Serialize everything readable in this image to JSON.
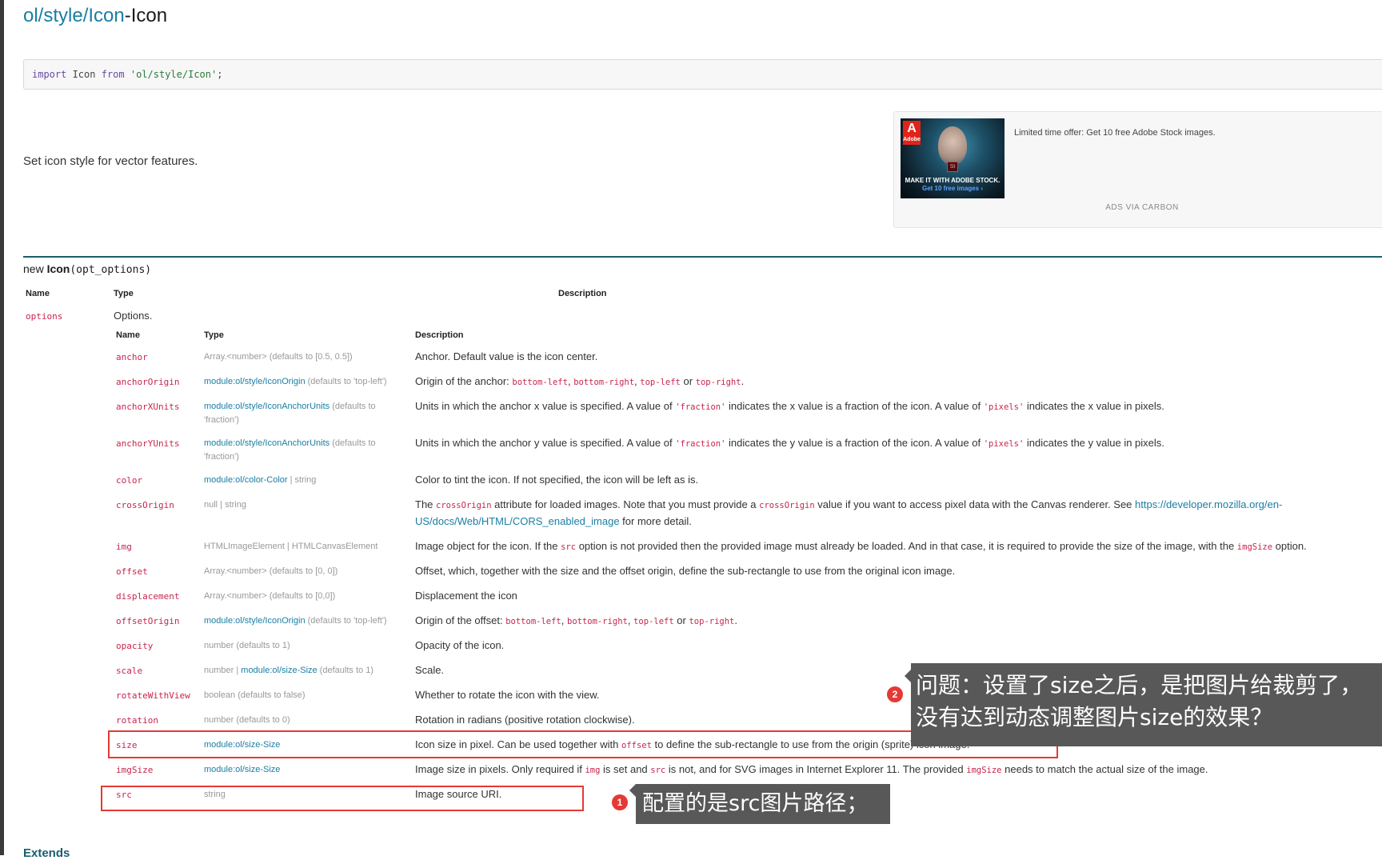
{
  "page": {
    "title_path": "ol/style/Icon",
    "title_suffix": "-Icon",
    "import_kw1": "import",
    "import_name": " Icon ",
    "import_kw2": "from",
    "import_str": " 'ol/style/Icon'",
    "import_end": ";",
    "summary": "Set icon style for vector features."
  },
  "ad": {
    "logo_text": "Adobe",
    "st_text": "St",
    "image_headline": "MAKE IT WITH ADOBE STOCK.",
    "image_cta": "Get 10 free images ›",
    "text": "Limited time offer: Get 10 free Adobe Stock images.",
    "via": "ADS VIA CARBON"
  },
  "constructor": {
    "prefix": "new ",
    "name": "Icon",
    "args": "(opt_options)"
  },
  "outer_headers": {
    "name": "Name",
    "type": "Type",
    "description": "Description"
  },
  "outer_row": {
    "name": "options",
    "type": "Options."
  },
  "inner_headers": {
    "name": "Name",
    "type": "Type",
    "description": "Description"
  },
  "options": [
    {
      "name": "anchor",
      "type_link": "",
      "type_text": "Array.<number> (defaults to [0.5, 0.5])",
      "type_text2": "",
      "desc": [
        {
          "t": "Anchor. Default value is the icon center."
        }
      ]
    },
    {
      "name": "anchorOrigin",
      "type_link": "module:ol/style/IconOrigin",
      "type_text": " (defaults to 'top-left')",
      "type_text2": "",
      "desc": [
        {
          "t": "Origin of the anchor: "
        },
        {
          "c": "bottom-left"
        },
        {
          "t": ", "
        },
        {
          "c": "bottom-right"
        },
        {
          "t": ", "
        },
        {
          "c": "top-left"
        },
        {
          "t": " or "
        },
        {
          "c": "top-right"
        },
        {
          "t": "."
        }
      ]
    },
    {
      "name": "anchorXUnits",
      "type_link": "module:ol/style/IconAnchorUnits",
      "type_text": " (defaults to 'fraction')",
      "type_text2": "",
      "desc": [
        {
          "t": "Units in which the anchor x value is specified. A value of "
        },
        {
          "c": "'fraction'"
        },
        {
          "t": " indicates the x value is a fraction of the icon. A value of "
        },
        {
          "c": "'pixels'"
        },
        {
          "t": " indicates the x value in pixels."
        }
      ]
    },
    {
      "name": "anchorYUnits",
      "type_link": "module:ol/style/IconAnchorUnits",
      "type_text": " (defaults to 'fraction')",
      "type_text2": "",
      "desc": [
        {
          "t": "Units in which the anchor y value is specified. A value of "
        },
        {
          "c": "'fraction'"
        },
        {
          "t": " indicates the y value is a fraction of the icon. A value of "
        },
        {
          "c": "'pixels'"
        },
        {
          "t": " indicates the y value in pixels."
        }
      ]
    },
    {
      "name": "color",
      "type_link": "module:ol/color-Color",
      "type_text": " | string",
      "type_text2": "",
      "desc": [
        {
          "t": "Color to tint the icon. If not specified, the icon will be left as is."
        }
      ]
    },
    {
      "name": "crossOrigin",
      "type_link": "",
      "type_text": "null | string",
      "type_text2": "",
      "desc": [
        {
          "t": "The "
        },
        {
          "c": "crossOrigin"
        },
        {
          "t": " attribute for loaded images. Note that you must provide a "
        },
        {
          "c": "crossOrigin"
        },
        {
          "t": " value if you want to access pixel data with the Canvas renderer. See "
        },
        {
          "u": "https://developer.mozilla.org/en-US/docs/Web/HTML/CORS_enabled_image"
        },
        {
          "t": " for more detail."
        }
      ]
    },
    {
      "name": "img",
      "type_link": "",
      "type_text": "HTMLImageElement | HTMLCanvasElement",
      "type_text2": "",
      "desc": [
        {
          "t": "Image object for the icon. If the "
        },
        {
          "c": "src"
        },
        {
          "t": " option is not provided then the provided image must already be loaded. And in that case, it is required to provide the size of the image, with the "
        },
        {
          "c": "imgSize"
        },
        {
          "t": " option."
        }
      ]
    },
    {
      "name": "offset",
      "type_link": "",
      "type_text": "Array.<number> (defaults to [0, 0])",
      "type_text2": "",
      "desc": [
        {
          "t": "Offset, which, together with the size and the offset origin, define the sub-rectangle to use from the original icon image."
        }
      ]
    },
    {
      "name": "displacement",
      "type_link": "",
      "type_text": "Array.<number> (defaults to [0,0])",
      "type_text2": "",
      "desc": [
        {
          "t": "Displacement the icon"
        }
      ]
    },
    {
      "name": "offsetOrigin",
      "type_link": "module:ol/style/IconOrigin",
      "type_text": " (defaults to 'top-left')",
      "type_text2": "",
      "desc": [
        {
          "t": "Origin of the offset: "
        },
        {
          "c": "bottom-left"
        },
        {
          "t": ", "
        },
        {
          "c": "bottom-right"
        },
        {
          "t": ", "
        },
        {
          "c": "top-left"
        },
        {
          "t": " or "
        },
        {
          "c": "top-right"
        },
        {
          "t": "."
        }
      ]
    },
    {
      "name": "opacity",
      "type_link": "",
      "type_text": "number (defaults to 1)",
      "type_text2": "",
      "desc": [
        {
          "t": "Opacity of the icon."
        }
      ]
    },
    {
      "name": "scale",
      "type_link": "module:ol/size-Size",
      "type_pre": "number | ",
      "type_text": " (defaults to 1)",
      "type_text2": "",
      "desc": [
        {
          "t": "Scale."
        }
      ]
    },
    {
      "name": "rotateWithView",
      "type_link": "",
      "type_text": "boolean (defaults to false)",
      "type_text2": "",
      "desc": [
        {
          "t": "Whether to rotate the icon with the view."
        }
      ]
    },
    {
      "name": "rotation",
      "type_link": "",
      "type_text": "number (defaults to 0)",
      "type_text2": "",
      "desc": [
        {
          "t": "Rotation in radians (positive rotation clockwise)."
        }
      ]
    },
    {
      "name": "size",
      "type_link": "module:ol/size-Size",
      "type_text": "",
      "type_text2": "",
      "desc": [
        {
          "t": "Icon size in pixel. Can be used together with "
        },
        {
          "c": "offset"
        },
        {
          "t": " to define the sub-rectangle to use from the origin (sprite) icon image."
        }
      ]
    },
    {
      "name": "imgSize",
      "type_link": "module:ol/size-Size",
      "type_text": "",
      "type_text2": "",
      "desc": [
        {
          "t": "Image size in pixels. Only required if "
        },
        {
          "c": "img"
        },
        {
          "t": " is set and "
        },
        {
          "c": "src"
        },
        {
          "t": " is not, and for SVG images in Internet Explorer 11. The provided "
        },
        {
          "c": "imgSize"
        },
        {
          "t": " needs to match the actual size of the image."
        }
      ]
    },
    {
      "name": "src",
      "type_link": "",
      "type_text": "string",
      "type_text2": "",
      "desc": [
        {
          "t": "Image source URI."
        }
      ]
    }
  ],
  "annotations": {
    "badge1": "1",
    "note1": "配置的是src图片路径；",
    "badge2": "2",
    "note2_line1": "问题：设置了size之后，是把图片给裁剪了，",
    "note2_line2": "没有达到动态调整图片size的效果？"
  },
  "footer": {
    "extends": "Extends"
  },
  "colors": {
    "accent": "#1a7ea3",
    "code_pink": "#c7254e",
    "annotation_red": "#e53935",
    "tooltip_gray": "#585858",
    "divider": "#1d5e6e"
  }
}
